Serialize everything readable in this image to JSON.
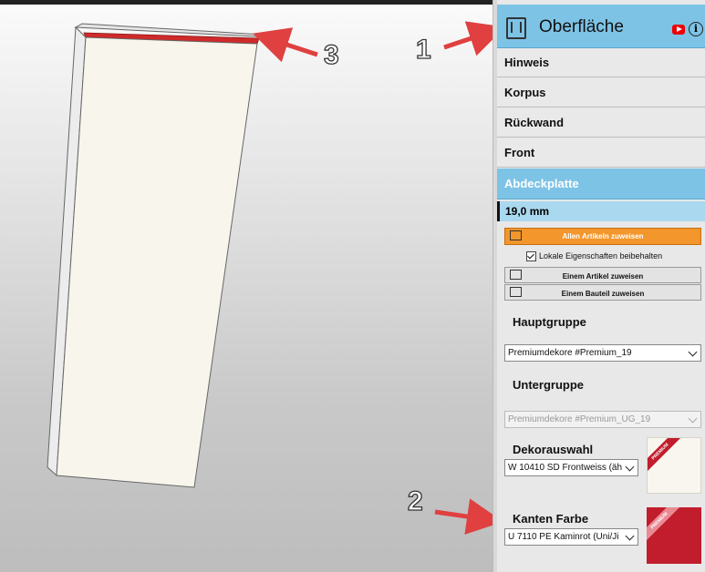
{
  "panel": {
    "title": "Oberfläche",
    "sections": [
      "Hinweis",
      "Korpus",
      "Rückwand",
      "Front",
      "Abdeckplatte"
    ],
    "thickness": "19,0 mm",
    "assign_all": "Allen Artikeln zuweisen",
    "keep_local": "Lokale Eigenschaften beibehalten",
    "assign_article": "Einem Artikel zuweisen",
    "assign_part": "Einem Bauteil zuweisen",
    "hauptgruppe_label": "Hauptgruppe",
    "hauptgruppe_value": "Premiumdekore #Premium_19",
    "untergruppe_label": "Untergruppe",
    "untergruppe_value": "Premiumdekore #Premium_UG_19",
    "dekor_label": "Dekorauswahl",
    "dekor_value": "W 10410 SD Frontweiss (äh",
    "kanten_label": "Kanten Farbe",
    "kanten_value": "U 7110 PE Kaminrot (Uni/Ji",
    "premium_badge": "PREMIUM"
  },
  "annotations": [
    "1",
    "2",
    "3"
  ],
  "colors": {
    "accent_blue": "#7dc3e6",
    "assign_orange": "#f3962b",
    "edge_red": "#c11d2c",
    "dekor_swatch": "#f8f6ee",
    "kanten_swatch": "#c11d2c",
    "arrow_red": "#e04040"
  }
}
